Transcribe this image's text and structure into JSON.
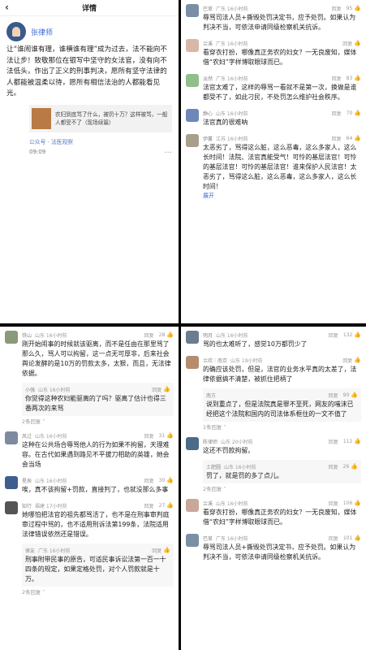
{
  "article": {
    "header_title": "详情",
    "back_icon": "back-arrow-icon",
    "author": "张律师",
    "body": "让“谁闹谁有理，谁横谁有理”成为过去，法不能向不法让步！致敬那位在银写中坚守的女法官，没有向不法低头，作出了正义的刑事判决，愿所有坚守法律的人都能被温柔以待，愿所有相信法治的人都能看见光。",
    "card_text": "农妇到底骂了什么，被罚十万？这样被骂，一般人都受不了（现场续篇）",
    "source": "公众号 · 法医观察",
    "time": "09:09",
    "more": "···"
  },
  "panelB": {
    "comments": [
      {
        "name": "巴草",
        "loc": "广东 16小时前",
        "reply": "回复",
        "likes": "95",
        "text": "辱骂司法人员+撕毁处罚决定书，应予处罚。如果认为判决不当，可依法申请同级检察机关抗诉。"
      },
      {
        "name": "兰溪",
        "loc": "广东 16小时前",
        "reply": "回复",
        "likes": "",
        "text": "看穿衣打扮，哪像真正务农的妇女？一无良废知，媒体借“农妇”字样博取眼球而已。"
      },
      {
        "name": "淡然",
        "loc": "广东 16小时前",
        "reply": "回复",
        "likes": "83",
        "text": "法官太难了，这样的辱骂一看就不是第一次，换做是谁都受不了，如此刁民，不处罚怎么维护社会秩序。"
      },
      {
        "name": "静心",
        "loc": "山东 16小时前",
        "reply": "回复",
        "likes": "70",
        "text": "法官真的很难呐"
      },
      {
        "name": "伊蔓",
        "loc": "江苏 16小时前",
        "reply": "回复",
        "likes": "64",
        "text": "太恶劣了，骂得这么脏，这么恶毒，这么多家人，这么长时间！法院、法官真能受气！可怜的基层法官！可怜的基层法官！可怜的基层法官！谁来保护人民法官！太恶劣了，骂得这么脏，这么恶毒，这么多家人，这么长时间！"
      }
    ],
    "expand": "展开"
  },
  "panelC": {
    "comments": [
      {
        "name": "铁山",
        "loc": "山东 16小时前",
        "reply": "回复",
        "likes": "28",
        "text": "刚开始闹事的时候就该驱离，而不是任由在那里骂了那么久，骂人可以拘留，这一点无可厚非，后来社会舆论发酵的是10万的罚款太多，太狠，而且，无法律依据。"
      },
      {
        "name": "小强",
        "loc": "山东 16小时前",
        "reply": "回复",
        "likes": "",
        "text": "你觉得这种农妇能驱离的了吗？驱离了估计也得三番两次的来骂"
      },
      {
        "name": "风过",
        "loc": "山东 16小时前",
        "reply": "回复",
        "likes": "31",
        "text": "这种在公共场合辱骂他人的行为如果不拘留，天理难容。在古代如果遇到路见不平拔刀相助的英雄，她会会当场"
      },
      {
        "name": "星辰",
        "loc": "山东 16小时前",
        "reply": "回复",
        "likes": "30",
        "text": "唉，真不该拘留+罚款，直接判了，也就没那么多事"
      },
      {
        "name": "知行",
        "loc": "福建 17小时前",
        "reply": "回复",
        "likes": "27",
        "text": "她哪怕把法官的祖先都骂活了，也不是在刑事审判庭审过程中骂的，也不适用刑诉法第199条，法院适用法律错误依然还是错误。"
      },
      {
        "name": "律友",
        "loc": "广东 16小时前",
        "reply": "回复",
        "likes": "",
        "text": "刑事附带民事的原告，可适民事诉讼法第一百一十四条的规定，如果定格处罚，对个人罚款就是十万。"
      }
    ],
    "more_replies": "2条回复 ˅",
    "more_replies2": "2条回复 ˅"
  },
  "panelD": {
    "comments": [
      {
        "name": "明月",
        "loc": "山东 16小时前",
        "reply": "回复",
        "likes": "132",
        "text": "骂的也太难听了，感觉10万都罚少了"
      },
      {
        "name": "兰欢｜南京",
        "loc": "山东 19小时前",
        "reply": "回复",
        "likes": "",
        "text": "的确应该处罚，但是，法官的业务水平真的太差了，法律依据搞不清楚，被抓住把柄了"
      },
      {
        "name": "南方",
        "loc": "",
        "reply": "回复",
        "likes": "90",
        "text": "说到重点了，但是法院真是罪不至死，网友的嗤沫已经把这个法院和国内的司法体系框住的一文不值了"
      },
      {
        "name": "陈律师",
        "loc": "山东 20小时前",
        "reply": "回复",
        "likes": "112",
        "text": "这还不罚款拘留。"
      },
      {
        "name": "土肥圆",
        "loc": "山东 16小时前",
        "reply": "回复",
        "likes": "26",
        "text": "罚了，就是罚的多了点儿。"
      },
      {
        "name": "兰溪",
        "loc": "山东 16小时前",
        "reply": "回复",
        "likes": "106",
        "text": "看穿衣打扮，哪像真正务农的妇女？一无良废知，媒体借“农妇”字样博取眼球而已。"
      },
      {
        "name": "巴草",
        "loc": "广东 16小时前",
        "reply": "回复",
        "likes": "101",
        "text": "辱骂司法人员+撕毁处罚决定书，应予处罚。如果认为判决不当，可依法申请同级检察机关抗诉。"
      }
    ],
    "more_1": "1条回复 ˅",
    "more_2": "2条回复 ˅"
  },
  "colors": {
    "link": "#3c6ad4",
    "muted": "#999999",
    "divider": "#000000"
  }
}
